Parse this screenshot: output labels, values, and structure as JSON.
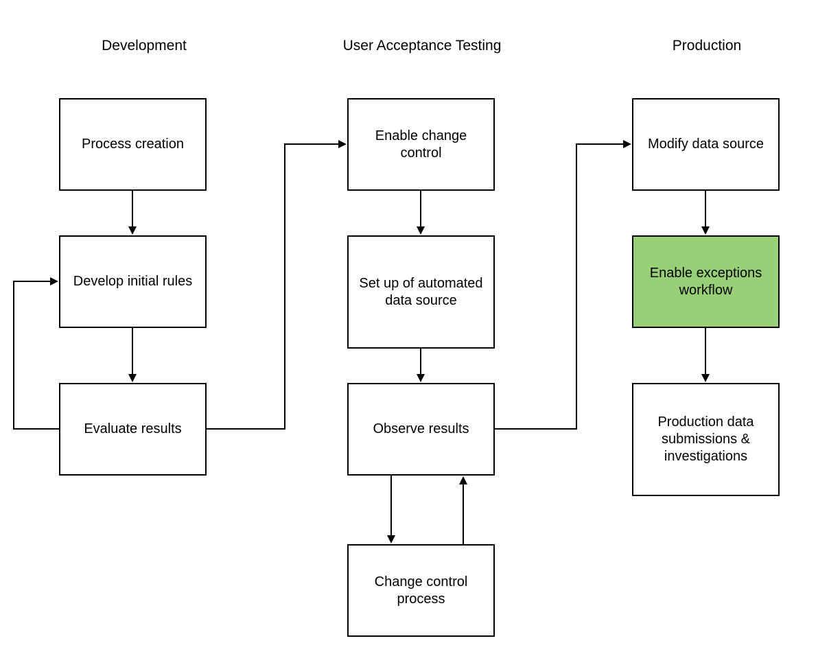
{
  "headings": {
    "development": "Development",
    "uat": "User Acceptance Testing",
    "production": "Production"
  },
  "nodes": {
    "process_creation": "Process creation",
    "develop_initial_rules": "Develop initial rules",
    "evaluate_results": "Evaluate results",
    "enable_change_control": "Enable change control",
    "setup_automated_data_source": "Set up of automated data source",
    "observe_results": "Observe results",
    "change_control_process": "Change control process",
    "modify_data_source": "Modify data source",
    "enable_exceptions_workflow": "Enable exceptions workflow",
    "production_data_submissions": "Production data submissions & investigations"
  },
  "highlight_color": "#97d077"
}
